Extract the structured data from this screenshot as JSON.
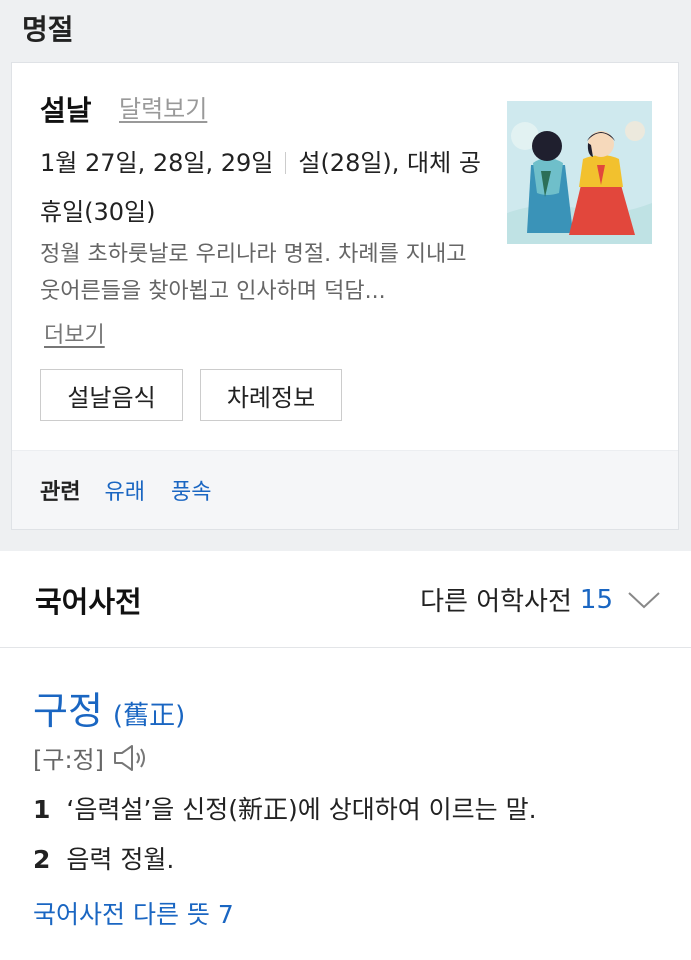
{
  "holiday_section": {
    "title": "명절",
    "card": {
      "name": "설날",
      "calendar_link": "달력보기",
      "dates": "1월 27일, 28일, 29일",
      "note": "설(28일), 대체 공휴일(30일)",
      "description": "정월 초하룻날로 우리나라 명절. 차례를 지내고 웃어른들을 찾아뵙고 인사하며 덕담...",
      "more_link": "더보기",
      "chips": [
        "설날음식",
        "차례정보"
      ],
      "related": {
        "label": "관련",
        "links": [
          "유래",
          "풍속"
        ]
      }
    }
  },
  "dictionary": {
    "title": "국어사전",
    "other_dicts_label": "다른 어학사전",
    "other_dicts_count": "15",
    "entry": {
      "headword": "구정",
      "hanja": "(舊正)",
      "pronunciation": "[구:정]",
      "definitions": [
        {
          "num": "1",
          "text": "‘음력설’을 신정(新正)에 상대하여 이르는 말."
        },
        {
          "num": "2",
          "text": "음력 정월."
        }
      ],
      "more_meanings": "국어사전 다른 뜻 7"
    }
  },
  "colors": {
    "accent": "#1a66c2",
    "section_bg": "#eef0f2"
  }
}
